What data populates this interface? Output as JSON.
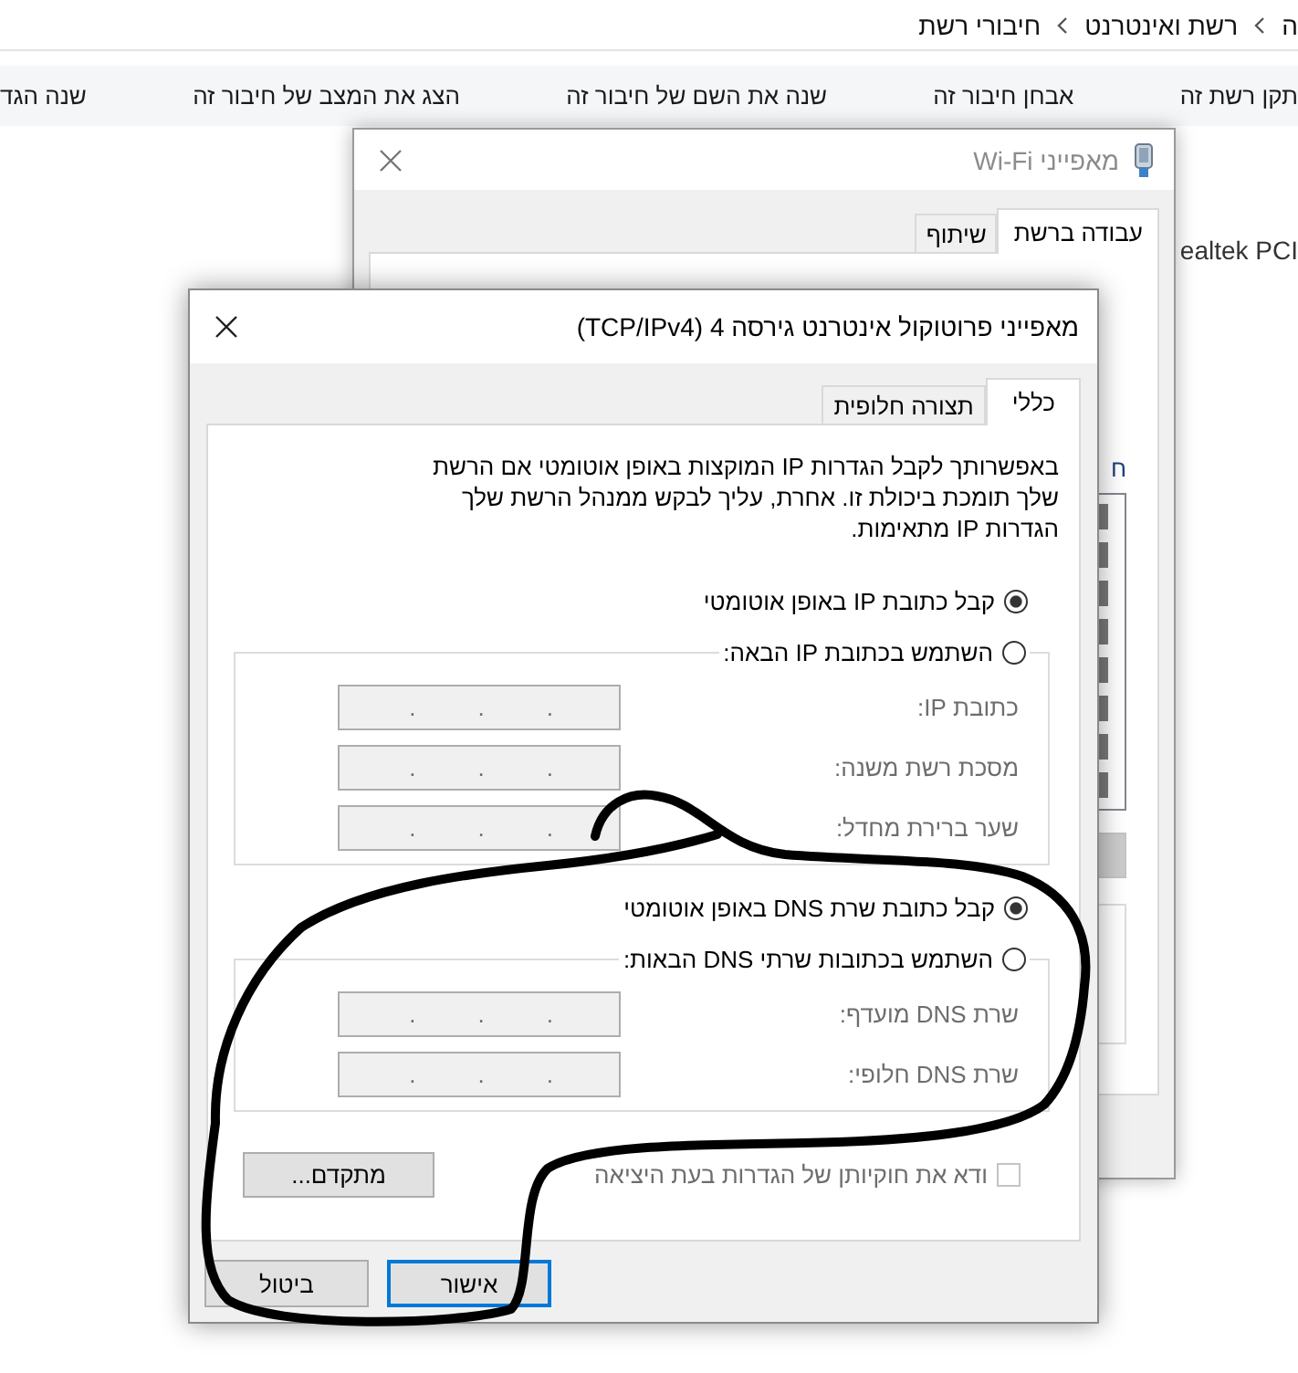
{
  "explorer": {
    "breadcrumb": [
      "ה",
      "רשת ואינטרנט",
      "חיבורי רשת"
    ],
    "toolbar": [
      "תקן רשת זה",
      "אבחן חיבור זה",
      "שנה את השם של חיבור זה",
      "הצג את המצב של חיבור זה",
      "שנה הגד"
    ],
    "adapter_text": "ealtek PCI"
  },
  "wifi_window": {
    "title": "מאפייני Wi-Fi",
    "tabs": [
      {
        "label": "עבודה ברשת",
        "selected": true
      },
      {
        "label": "שיתוף",
        "selected": false
      }
    ],
    "list_label": "ח"
  },
  "ipv4_dialog": {
    "title": "מאפייני פרוטוקול אינטרנט גירסה 4 (TCP/IPv4)",
    "tabs": [
      {
        "label": "כללי",
        "selected": true
      },
      {
        "label": "תצורה חלופית",
        "selected": false
      }
    ],
    "description": "באפשרותך לקבל הגדרות IP המוקצות באופן אוטומטי אם הרשת שלך תומכת ביכולת זו. אחרת, עליך לבקש ממנהל הרשת שלך הגדרות IP מתאימות.",
    "ip_section": {
      "options": [
        {
          "label": "קבל כתובת IP באופן אוטומטי",
          "selected": true
        },
        {
          "label": "השתמש בכתובת IP הבאה:",
          "selected": false
        }
      ],
      "fields": [
        {
          "label": "כתובת IP:",
          "separators": [
            ".",
            ".",
            "."
          ],
          "disabled": true
        },
        {
          "label": "מסכת רשת משנה:",
          "separators": [
            ".",
            ".",
            "."
          ],
          "disabled": true
        },
        {
          "label": "שער ברירת מחדל:",
          "separators": [
            ".",
            ".",
            "."
          ],
          "disabled": true
        }
      ]
    },
    "dns_section": {
      "options": [
        {
          "label": "קבל כתובת שרת DNS באופן אוטומטי",
          "selected": true
        },
        {
          "label": "השתמש בכתובות שרתי DNS הבאות:",
          "selected": false
        }
      ],
      "fields": [
        {
          "label": "שרת DNS מועדף:",
          "separators": [
            ".",
            ".",
            "."
          ],
          "disabled": true
        },
        {
          "label": "שרת DNS חלופי:",
          "separators": [
            ".",
            ".",
            "."
          ],
          "disabled": true
        }
      ]
    },
    "validate_checkbox": {
      "label": "ודא את חוקיותן של הגדרות בעת היציאה",
      "checked": false,
      "disabled": true
    },
    "advanced_button": "מתקדם...",
    "buttons": [
      {
        "label": "אישור",
        "default": true
      },
      {
        "label": "ביטול",
        "default": false
      }
    ]
  },
  "annotation": {
    "kind": "freehand-loop"
  }
}
